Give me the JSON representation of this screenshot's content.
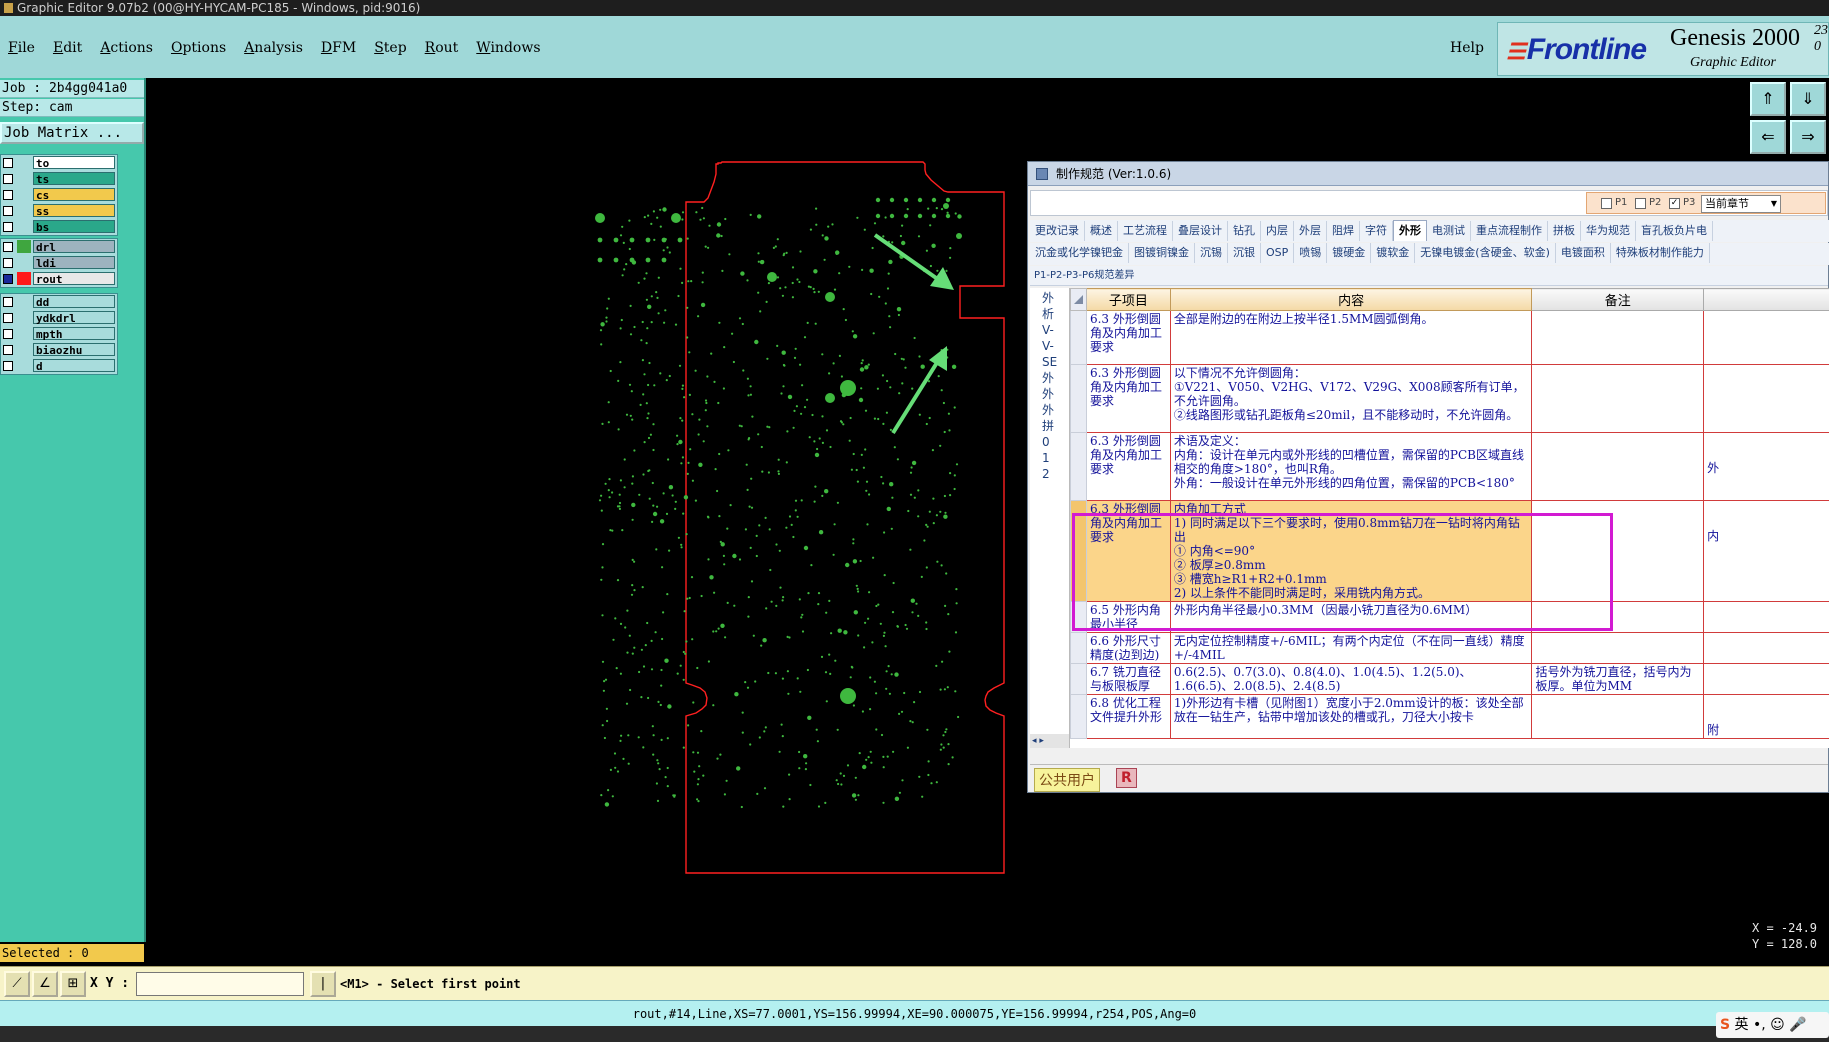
{
  "window": {
    "title": "Graphic Editor 9.07b2 (00@HY-HYCAM-PC185 - Windows, pid:9016)"
  },
  "menu": {
    "items": [
      "File",
      "Edit",
      "Actions",
      "Options",
      "Analysis",
      "DFM",
      "Step",
      "Rout",
      "Windows"
    ],
    "help": "Help"
  },
  "brand": {
    "logo": "Frontline",
    "product": "Genesis 2000",
    "subtitle": "Graphic Editor",
    "version_top": "23",
    "version_bottom": "0"
  },
  "job": {
    "job_line": "Job : 2b4gg041a0",
    "step_line": "Step: cam",
    "matrix_button": "Job Matrix ..."
  },
  "layers": {
    "group1": [
      {
        "name": "to",
        "color": "#ffffff"
      },
      {
        "name": "ts",
        "color": "#2aa88a"
      },
      {
        "name": "cs",
        "color": "#f2c94c"
      },
      {
        "name": "ss",
        "color": "#f2c94c"
      },
      {
        "name": "bs",
        "color": "#2aa88a"
      }
    ],
    "group2": [
      {
        "name": "drl",
        "color": "#9db3bf",
        "swatch": "#3fa63f"
      },
      {
        "name": "ldi",
        "color": "#9db3bf",
        "swatch": ""
      },
      {
        "name": "rout",
        "color": "#e8e8e8",
        "swatch": "#ff1a1a"
      }
    ],
    "group3": [
      {
        "name": "dd",
        "color": "#a8dcdc"
      },
      {
        "name": "ydkdrl",
        "color": "#a8dcdc"
      },
      {
        "name": "mpth",
        "color": "#a8dcdc"
      },
      {
        "name": "biaozhu",
        "color": "#a8dcdc"
      },
      {
        "name": "d",
        "color": "#a8dcdc"
      }
    ]
  },
  "selected_text": "Selected : 0",
  "commandbar": {
    "xy_label": "X Y :",
    "xy_value": "",
    "prompt": "<M1> - Select first point"
  },
  "statusbar": {
    "text": "rout,#14,Line,XS=77.0001,YS=156.99994,XE=90.000075,YE=156.99994,r254,POS,Ang=0"
  },
  "coords": {
    "x": "X = -24.9",
    "y": "Y = 128.0"
  },
  "ime": {
    "text": "英"
  },
  "dialog": {
    "title": "制作规范 (Ver:1.0.6)",
    "filters": {
      "p1": "P1",
      "p2": "P2",
      "p3": "P3",
      "p3_checked": true,
      "chapter": "当前章节"
    },
    "tabs_row1": [
      "更改记录",
      "概述",
      "工艺流程",
      "叠层设计",
      "钻孔",
      "内层",
      "外层",
      "阻焊",
      "字符",
      "外形",
      "电测试",
      "重点流程制作",
      "拼板",
      "华为规范",
      "盲孔板负片电"
    ],
    "tabs_row2": [
      "沉金或化学镍钯金",
      "图镀铜镍金",
      "沉锡",
      "沉银",
      "OSP",
      "喷锡",
      "镀硬金",
      "镀软金",
      "无镍电镀金(含硬金、软金)",
      "电镀面积",
      "特殊板材制作能力"
    ],
    "active_tab": "外形",
    "subtab": "P1-P2-P3-P6规范差异",
    "left_list": [
      "外",
      "析",
      "V-",
      "V-",
      "SE",
      "外",
      "外",
      "外",
      "拼",
      "0",
      "1",
      "2"
    ],
    "columns": {
      "sub": "子项目",
      "content": "内容",
      "note": "备注"
    },
    "rows": [
      {
        "sub": "6.3 外形倒圆角及内角加工要求",
        "content": [
          "全部是附边的在附边上按半径1.5MM圆弧倒角。"
        ],
        "note": "",
        "extra": ""
      },
      {
        "sub": "6.3 外形倒圆角及内角加工要求",
        "content": [
          "以下情况不允许倒圆角：",
          "①V221、V050、V2HG、V172、V29G、X008顾客所有订单，不允许圆角。",
          "②线路图形或钻孔距板角≤20mil，且不能移动时，不允许圆角。"
        ],
        "note": "",
        "extra": ""
      },
      {
        "sub": "6.3 外形倒圆角及内角加工要求",
        "content": [
          "术语及定义：",
          "内角：设计在单元内或外形线的凹槽位置，需保留的PCB区域直线相交的角度>180°，也叫R角。",
          "外角：一般设计在单元外形线的四角位置，需保留的PCB<180°"
        ],
        "note": "",
        "extra": "外"
      },
      {
        "sub": "6.3 外形倒圆角及内角加工要求",
        "content": [
          "内角加工方式",
          "1) 同时满足以下三个要求时，使用0.8mm钻刀在一钻时将内角钻出",
          "① 内角<=90°",
          "② 板厚≥0.8mm",
          "③ 槽宽h≥R1+R2+0.1mm",
          "2) 以上条件不能同时满足时，采用铣内角方式。"
        ],
        "note": "",
        "extra": "内",
        "highlight": true
      },
      {
        "sub": "6.5 外形内角最小半径",
        "content": [
          "外形内角半径最小0.3MM（因最小铣刀直径为0.6MM）"
        ],
        "note": "",
        "extra": ""
      },
      {
        "sub": "6.6 外形尺寸精度(边到边)",
        "content": [
          "无内定位控制精度+/-6MIL；有两个内定位（不在同一直线）精度+/-4MIL"
        ],
        "note": "",
        "extra": ""
      },
      {
        "sub": "6.7 铣刀直径与板限板厚",
        "content": [
          "0.6(2.5)、0.7(3.0)、0.8(4.0)、1.0(4.5)、1.2(5.0)、1.6(6.5)、2.0(8.5)、2.4(8.5)"
        ],
        "note": "括号外为铣刀直径，括号内为板厚。单位为MM",
        "extra": ""
      },
      {
        "sub": "6.8 优化工程文件提升外形",
        "content": [
          "1)外形边有卡槽（见附图1）宽度小于2.0mm设计的板：该处全部放在一钻生产，钻带中增加该处的槽或孔，刀径大小按卡"
        ],
        "note": "",
        "extra": "附"
      }
    ],
    "footer_user": "公共用户",
    "footer_r": "R"
  },
  "colors": {
    "board_outline": "#ff2020",
    "pads": "#3fb83f",
    "arrow": "#66dd77",
    "highlight_border": "#d21ad2"
  }
}
